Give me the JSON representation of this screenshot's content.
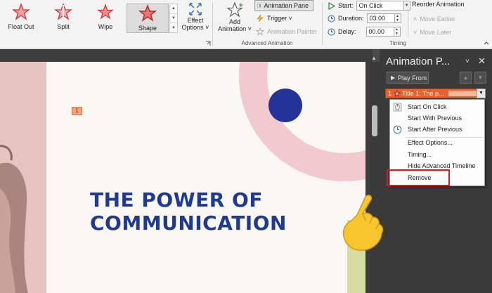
{
  "ribbon": {
    "animations": [
      {
        "label": "Float Out",
        "icon": "float-out-star-icon"
      },
      {
        "label": "Split",
        "icon": "split-star-icon"
      },
      {
        "label": "Wipe",
        "icon": "wipe-star-icon"
      },
      {
        "label": "Shape",
        "icon": "shape-star-icon",
        "selected": true
      }
    ],
    "effect_options": {
      "line1": "Effect",
      "line2": "Options ˅"
    },
    "advanced_animation": {
      "add_animation_line1": "Add",
      "add_animation_line2": "Animation ˅",
      "animation_pane": "Animation Pane",
      "trigger": "Trigger ˅",
      "animation_painter": "Animation Painter",
      "group_label": "Advanced Animation"
    },
    "timing": {
      "start_label": "Start:",
      "start_value": "On Click",
      "duration_label": "Duration:",
      "duration_value": "03.00",
      "delay_label": "Delay:",
      "delay_value": "00.00",
      "reorder_title": "Reorder Animation",
      "move_earlier": "Move Earlier",
      "move_later": "Move Later",
      "group_label": "Timing"
    }
  },
  "slide": {
    "tag": "1",
    "title_line1": "THE POWER OF",
    "title_line2": "COMMUNICATION",
    "colors": {
      "title": "#1f3a93",
      "dot": "#23339a",
      "arc": "#f2c9cc",
      "accent_bar": "#d6dda1"
    }
  },
  "pane": {
    "title": "Animation P...",
    "play_from": "Play From",
    "item": {
      "number": "1",
      "title": "Title 1: The p..."
    }
  },
  "menu": {
    "items": [
      {
        "label": "Start On Click",
        "icon": "mouse-click-icon"
      },
      {
        "label": "Start With Previous",
        "icon": ""
      },
      {
        "label": "Start After Previous",
        "icon": "clock-icon"
      },
      {
        "label": "Effect Options...",
        "icon": ""
      },
      {
        "label": "Timing...",
        "icon": ""
      },
      {
        "label": "Hide Advanced Timeline",
        "icon": ""
      },
      {
        "label": "Remove",
        "icon": "",
        "highlighted": true
      }
    ]
  },
  "colors": {
    "accent": "#e8602c",
    "highlight_box": "#d61b1b"
  }
}
